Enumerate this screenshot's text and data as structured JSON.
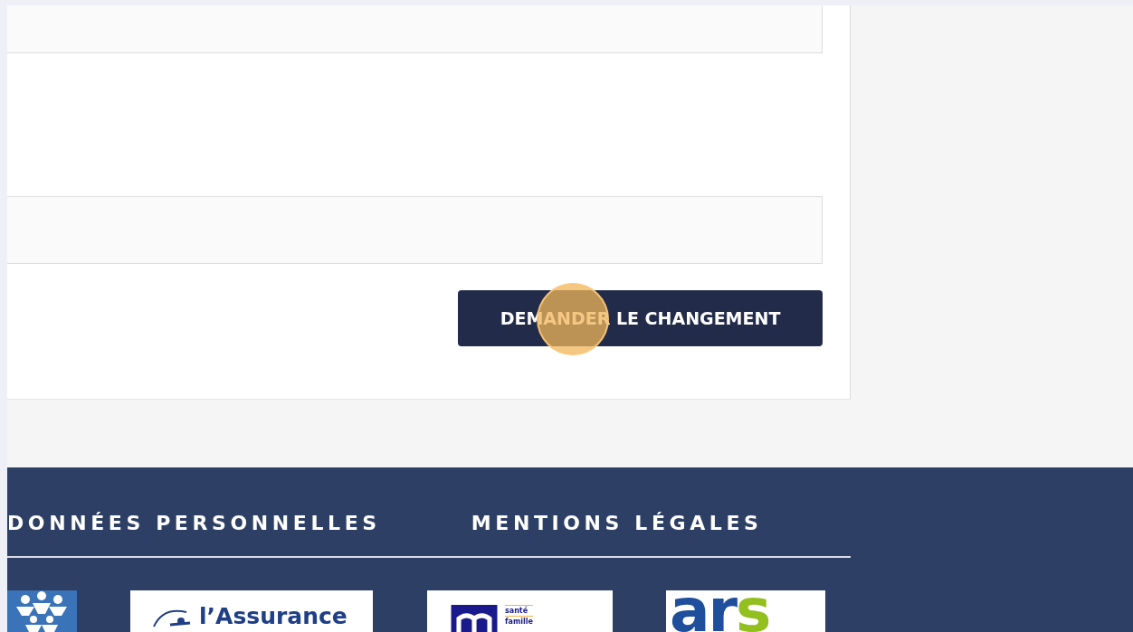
{
  "form": {
    "fields": [
      {
        "kind": "text"
      },
      {
        "kind": "text"
      }
    ],
    "submit_button": {
      "label": "DEMANDER LE CHANGEMENT"
    },
    "click_marker": {
      "shown": true
    }
  },
  "footer": {
    "links": [
      "DONNÉES PERSONNELLES",
      "MENTIONS LÉGALES"
    ],
    "logos": [
      {
        "kind": "figures"
      },
      {
        "kind": "assurance",
        "text": "l’Assurance"
      },
      {
        "kind": "mutuelle",
        "lines": [
          "santé",
          "famille"
        ]
      },
      {
        "kind": "letters",
        "parts": [
          {
            "text": "ar",
            "color": "#1f4e9c"
          },
          {
            "text": "s",
            "color": "#93c01f"
          }
        ]
      }
    ]
  }
}
